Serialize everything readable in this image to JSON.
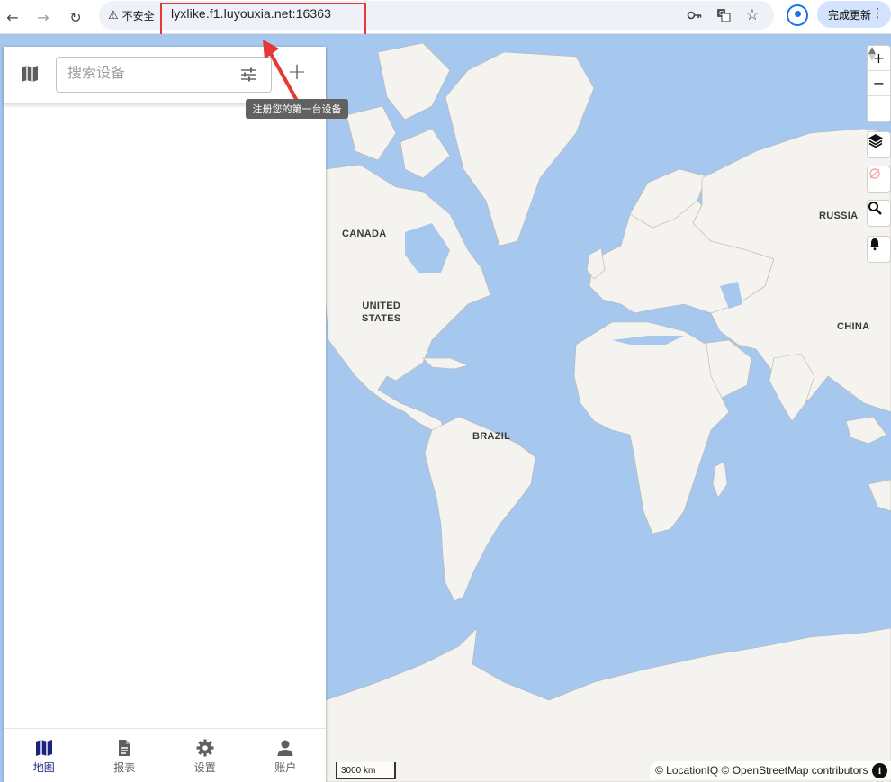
{
  "browser": {
    "back_icon": "arrow-left-icon",
    "forward_icon": "arrow-right-icon",
    "reload_icon": "reload-icon",
    "security_label": "不安全",
    "url": "lyxlike.f1.luyouxia.net:16363",
    "update_button_label": "完成更新",
    "highlight_color": "#e53935"
  },
  "panel": {
    "search": {
      "placeholder": "搜索设备",
      "value": ""
    },
    "add_tooltip": "注册您的第一台设备"
  },
  "map": {
    "labels": {
      "canada": "CANADA",
      "united_states": "UNITED\nSTATES",
      "russia": "RUSSIA",
      "china": "CHINA",
      "brazil": "BRAZIL"
    },
    "scale": "3000 km",
    "attribution": "© LocationIQ © OpenStreetMap contributors",
    "info_label": "i",
    "ocean_color": "#a6c8ee",
    "land_color": "#f5f3ef"
  },
  "bottom_nav": {
    "items": [
      {
        "label": "地图",
        "icon": "map-icon",
        "active": true
      },
      {
        "label": "报表",
        "icon": "report-icon",
        "active": false
      },
      {
        "label": "设置",
        "icon": "gear-icon",
        "active": false
      },
      {
        "label": "账户",
        "icon": "person-icon",
        "active": false
      }
    ]
  }
}
